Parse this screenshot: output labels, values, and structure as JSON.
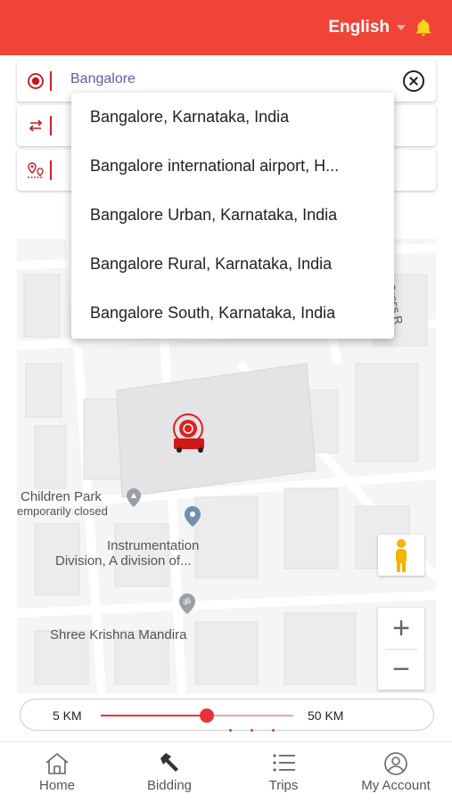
{
  "header": {
    "language": "English",
    "bell_icon": "bell-icon",
    "color": "#f04438"
  },
  "fields": {
    "pickup": {
      "value": "Bangalore",
      "icon": "pickup-location-icon"
    },
    "exchange": {
      "value": "",
      "icon": "swap-arrows-icon"
    },
    "drop": {
      "value": "",
      "icon": "drop-location-icon"
    }
  },
  "suggestions": [
    "Bangalore, Karnataka, India",
    "Bangalore international airport, H...",
    "Bangalore Urban, Karnataka, India",
    "Bangalore Rural, Karnataka, India",
    "Bangalore South, Karnataka, India"
  ],
  "map": {
    "labels": {
      "children_park": "Children Park",
      "temporarily_closed": "emporarily closed",
      "instrumentation_1": "Instrumentation",
      "instrumentation_2": "Division, A division of...",
      "temple": "Shree Krishna Mandira",
      "road": "10th Cross R"
    },
    "zoom_in": "+",
    "zoom_out": "−"
  },
  "radius": {
    "min_label": "5 KM",
    "max_label": "50 KM",
    "value_fraction": 0.55,
    "accent": "#e8323a"
  },
  "nav": [
    {
      "label": "Home",
      "icon": "home-icon"
    },
    {
      "label": "Bidding",
      "icon": "hammer-icon"
    },
    {
      "label": "Trips",
      "icon": "list-icon"
    },
    {
      "label": "My Account",
      "icon": "account-icon"
    }
  ]
}
